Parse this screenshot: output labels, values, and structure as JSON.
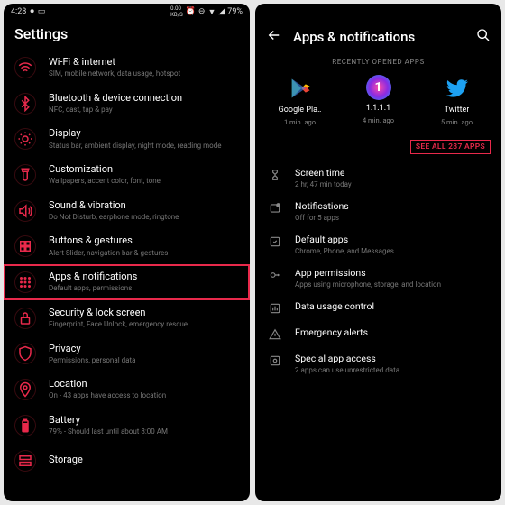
{
  "statusbar": {
    "time": "4:28",
    "battery": "79%"
  },
  "left": {
    "title": "Settings",
    "items": [
      {
        "title": "Wi-Fi & internet",
        "sub": "SIM, mobile network, data usage, hotspot"
      },
      {
        "title": "Bluetooth & device connection",
        "sub": "NFC, cast, tap & pay"
      },
      {
        "title": "Display",
        "sub": "Status bar, ambient display, night mode, reading mode"
      },
      {
        "title": "Customization",
        "sub": "Wallpapers, accent color, font, tone"
      },
      {
        "title": "Sound & vibration",
        "sub": "Do Not Disturb, earphone mode, ringtone"
      },
      {
        "title": "Buttons & gestures",
        "sub": "Alert Slider, navigation bar & gestures"
      },
      {
        "title": "Apps & notifications",
        "sub": "Default apps, permissions"
      },
      {
        "title": "Security & lock screen",
        "sub": "Fingerprint, Face Unlock, emergency rescue"
      },
      {
        "title": "Privacy",
        "sub": "Permissions, personal data"
      },
      {
        "title": "Location",
        "sub": "On - 43 apps have access to location"
      },
      {
        "title": "Battery",
        "sub": "79% - Should last until about 8:00 AM"
      },
      {
        "title": "Storage",
        "sub": ""
      }
    ],
    "highlight_index": 6
  },
  "right": {
    "title": "Apps & notifications",
    "section_label": "RECENTLY OPENED APPS",
    "recent": [
      {
        "name": "Google Pla‥",
        "sub": "1 min. ago"
      },
      {
        "name": "1.1.1.1",
        "sub": "4 min. ago"
      },
      {
        "name": "Twitter",
        "sub": "5 min. ago"
      }
    ],
    "see_all": "SEE ALL 287 APPS",
    "items": [
      {
        "title": "Screen time",
        "sub": "2 hr, 47 min today"
      },
      {
        "title": "Notifications",
        "sub": "Off for 5 apps"
      },
      {
        "title": "Default apps",
        "sub": "Chrome, Phone, and Messages"
      },
      {
        "title": "App permissions",
        "sub": "Apps using microphone, storage, and location"
      },
      {
        "title": "Data usage control",
        "sub": ""
      },
      {
        "title": "Emergency alerts",
        "sub": ""
      },
      {
        "title": "Special app access",
        "sub": "2 apps can use unrestricted data"
      }
    ]
  },
  "colors": {
    "accent": "#e8294b"
  }
}
